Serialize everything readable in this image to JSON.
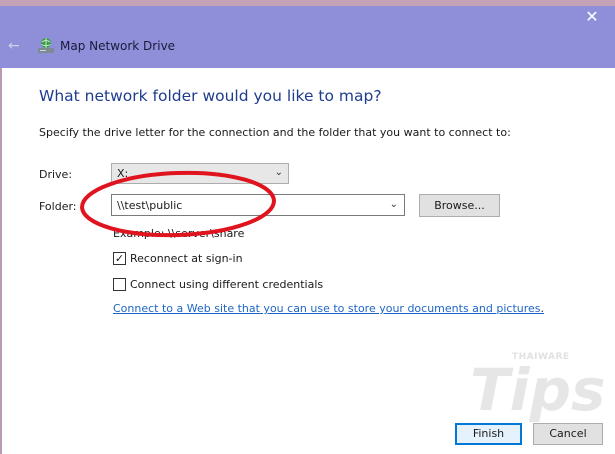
{
  "window": {
    "title": "Map Network Drive",
    "close_icon": "✕",
    "back_icon": "←"
  },
  "main": {
    "heading": "What network folder would you like to map?",
    "instruction": "Specify the drive letter for the connection and the folder that you want to connect to:",
    "drive_label": "Drive:",
    "drive_value": "X:",
    "folder_label": "Folder:",
    "folder_value": "\\\\test\\public",
    "browse_label": "Browse...",
    "example_text": "Example: \\\\server\\share",
    "reconnect_label": "Reconnect at sign-in",
    "reconnect_checked": true,
    "credentials_label": "Connect using different credentials",
    "credentials_checked": false,
    "web_link": "Connect to a Web site that you can use to store your documents and pictures",
    "web_link_suffix": "."
  },
  "footer": {
    "finish_label": "Finish",
    "cancel_label": "Cancel"
  },
  "watermark": {
    "brand_small": "THAIWARE",
    "brand_large": "Tips"
  },
  "colors": {
    "titlebar": "#8f8fd9",
    "heading": "#1f3d8f",
    "link": "#1e66c6",
    "annotation": "#e0141e",
    "accent": "#0078d7"
  },
  "icons": {
    "chevron": "⌄",
    "check": "✓"
  }
}
